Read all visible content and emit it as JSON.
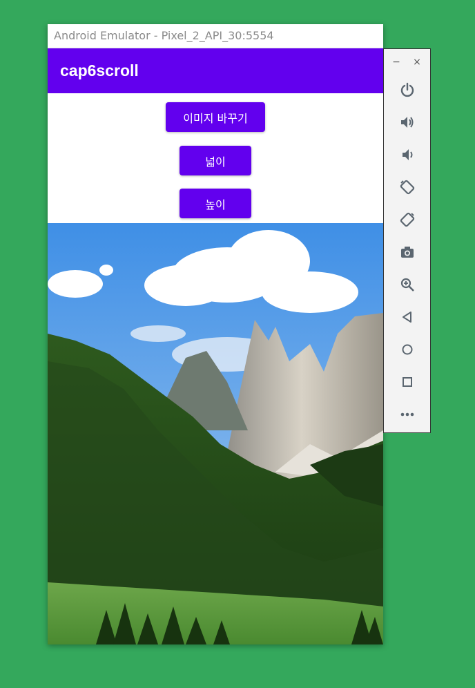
{
  "emulator": {
    "title": "Android Emulator - Pixel_2_API_30:5554"
  },
  "app": {
    "title": "cap6scroll"
  },
  "buttons": {
    "change_image": "이미지 바꾸기",
    "width": "넓이",
    "height": "높이"
  },
  "toolbar": {
    "minimize": "−",
    "close": "×",
    "tools": [
      "power-icon",
      "volume-up-icon",
      "volume-down-icon",
      "rotate-left-icon",
      "rotate-right-icon",
      "camera-icon",
      "zoom-in-icon",
      "back-icon",
      "home-icon",
      "overview-icon",
      "more-icon"
    ]
  },
  "colors": {
    "accent": "#6200ee",
    "desktop": "#34a85c"
  }
}
